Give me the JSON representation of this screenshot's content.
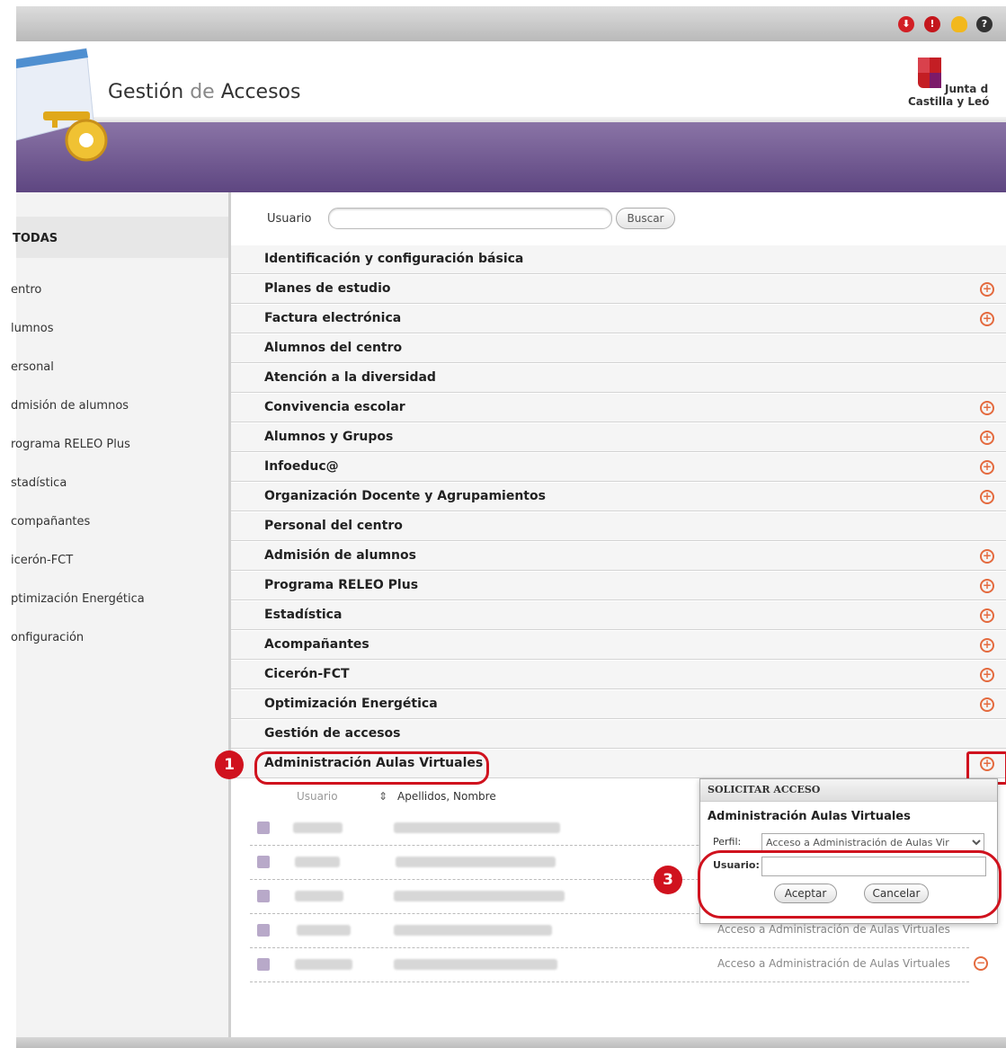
{
  "app": {
    "title": "Gestión de Accesos",
    "title_part1": "Gestión",
    "title_part2": "de",
    "title_part3": "Accesos"
  },
  "brand": {
    "line1": "Junta d",
    "line2": "Castilla y Leó"
  },
  "sidebar": {
    "selected": "TODAS",
    "items": [
      "entro",
      "lumnos",
      "ersonal",
      "dmisión de alumnos",
      "rograma RELEO Plus",
      "stadística",
      "compañantes",
      "icerón-FCT",
      "ptimización Energética",
      "onfiguración"
    ]
  },
  "search": {
    "label": "Usuario",
    "value": "",
    "button": "Buscar"
  },
  "modules": [
    {
      "label": "Identificación y configuración básica"
    },
    {
      "label": "Planes de estudio"
    },
    {
      "label": "Factura electrónica"
    },
    {
      "label": "Alumnos del centro"
    },
    {
      "label": "Atención a la diversidad"
    },
    {
      "label": "Convivencia escolar"
    },
    {
      "label": "Alumnos y Grupos"
    },
    {
      "label": "Infoeduc@"
    },
    {
      "label": "Organización Docente y Agrupamientos"
    },
    {
      "label": "Personal del centro"
    },
    {
      "label": "Admisión de alumnos"
    },
    {
      "label": "Programa RELEO Plus"
    },
    {
      "label": "Estadística"
    },
    {
      "label": "Acompañantes"
    },
    {
      "label": "Cicerón-FCT"
    },
    {
      "label": "Optimización Energética"
    },
    {
      "label": "Gestión de accesos"
    },
    {
      "label": "Administración Aulas Virtuales"
    }
  ],
  "table": {
    "col_user": "Usuario",
    "col_name": "Apellidos, Nombre",
    "rows": [
      {
        "profile": ""
      },
      {
        "profile": ""
      },
      {
        "profile": ""
      },
      {
        "profile": "Acceso a Administración de Aulas Virtuales"
      },
      {
        "profile": "Acceso a Administración de Aulas Virtuales"
      }
    ]
  },
  "popup": {
    "header": "SOLICITAR ACCESO",
    "title": "Administración Aulas Virtuales",
    "perfil_label": "Perfil:",
    "perfil_value": "Acceso a Administración de Aulas Vir",
    "usuario_label": "Usuario:",
    "usuario_value": "",
    "accept": "Aceptar",
    "cancel": "Cancelar"
  },
  "annotations": [
    "1",
    "3"
  ],
  "colors": {
    "accent": "#5e4681",
    "annotation": "#d0121e",
    "icon": "#e46a3e"
  },
  "icons": [
    "key-logo-icon",
    "download-icon",
    "stop-icon",
    "lightbulb-icon",
    "help-icon",
    "plus-circle-icon",
    "minus-circle-icon",
    "user-icon"
  ]
}
